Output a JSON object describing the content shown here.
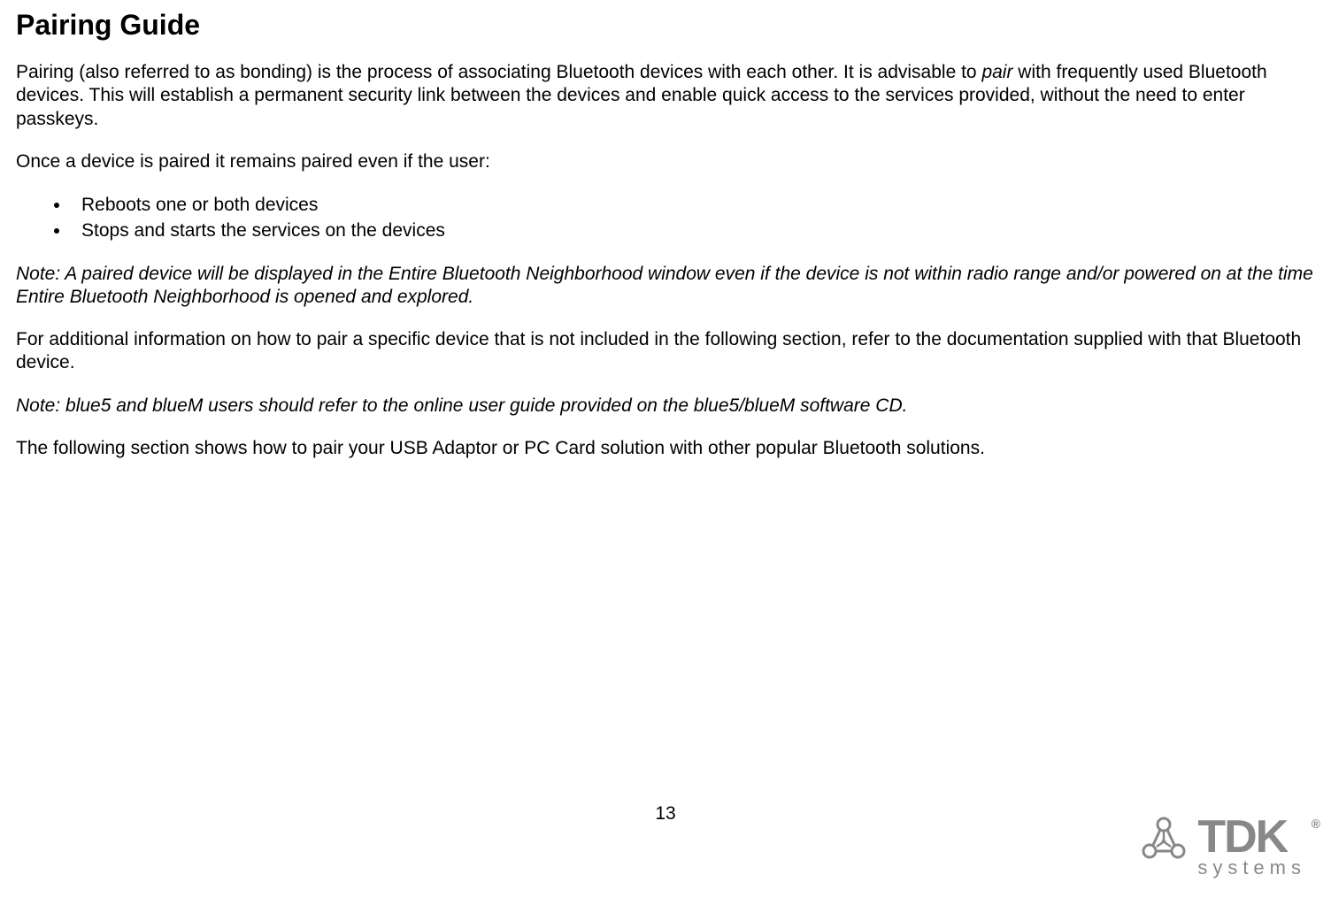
{
  "heading": "Pairing Guide",
  "para1_part1": "Pairing (also referred to as bonding) is the process of associating Bluetooth devices with each other. It is advisable to ",
  "para1_italic": "pair",
  "para1_part2": " with frequently used Bluetooth devices. This will establish a permanent security link between the devices and enable quick access to the services provided, without the need to enter passkeys.",
  "para2": "Once a device is paired it remains paired even if the user:",
  "bullets": [
    "Reboots one or both devices",
    "Stops and starts the services on the devices"
  ],
  "note1": "Note: A paired device will be displayed in the Entire Bluetooth Neighborhood window even if the device is not within radio range and/or powered on at the time Entire Bluetooth Neighborhood is opened and explored.",
  "para3": "For additional information on how to pair a specific device that is not included in the following section, refer to the documentation supplied with that Bluetooth device.",
  "note2": "Note: blue5 and blueM users should refer to the online user guide provided on the blue5/blueM software CD.",
  "para4": "The following section shows how to pair your USB Adaptor or PC Card solution with other popular Bluetooth solutions.",
  "page_number": "13",
  "logo": {
    "brand": "TDK",
    "reg": "®",
    "sub": "systems"
  }
}
